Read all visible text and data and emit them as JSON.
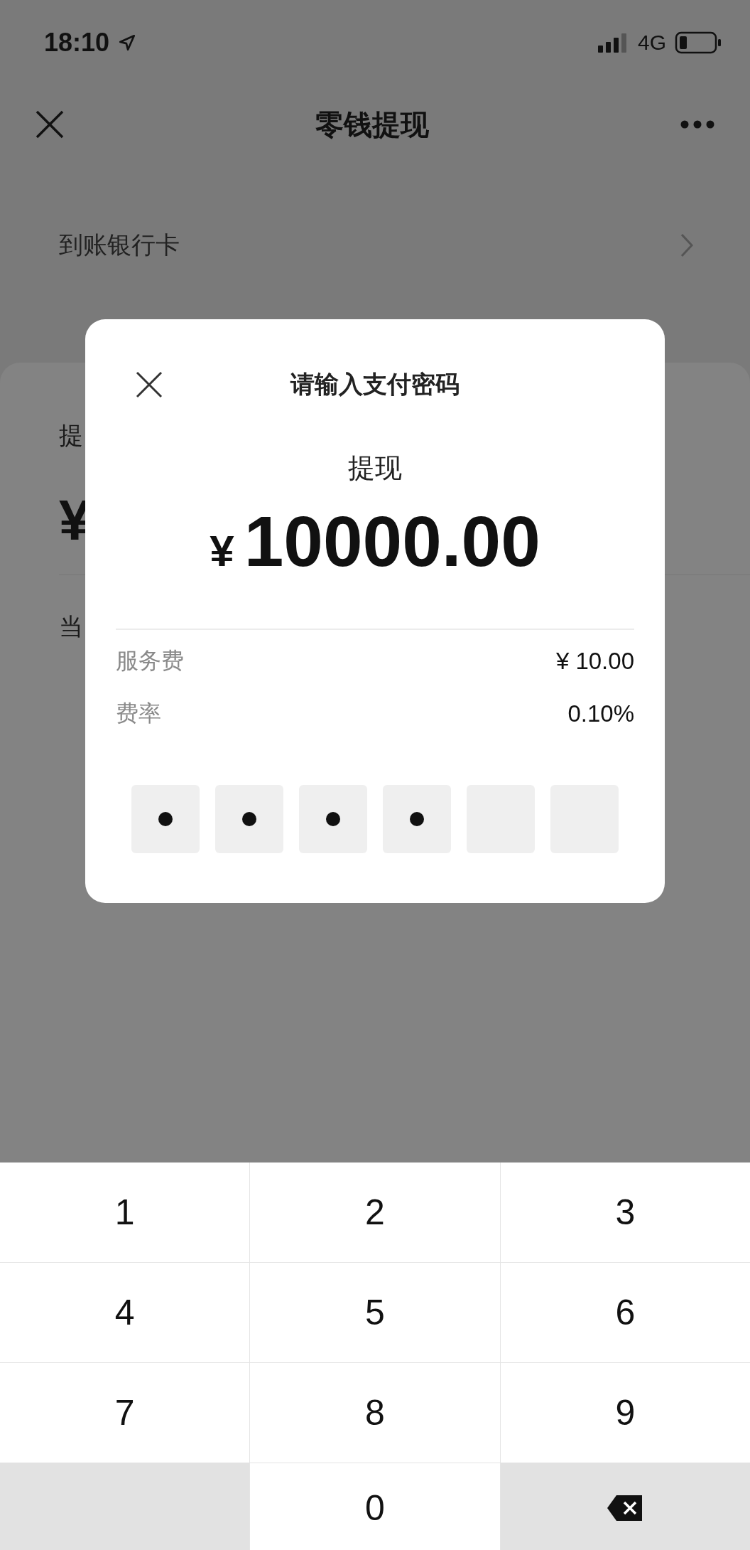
{
  "status_bar": {
    "time": "18:10",
    "network": "4G"
  },
  "nav": {
    "title": "零钱提现"
  },
  "bank_row": {
    "label": "到账银行卡"
  },
  "background_card": {
    "title_fragment": "提",
    "amount_fragment": "¥",
    "note_fragment": "当"
  },
  "dialog": {
    "title": "请输入支付密码",
    "subtitle": "提现",
    "currency": "¥",
    "amount": "10000.00",
    "details": [
      {
        "label": "服务费",
        "value": "¥ 10.00"
      },
      {
        "label": "费率",
        "value": "0.10%"
      }
    ],
    "pin": [
      {
        "filled": true
      },
      {
        "filled": true
      },
      {
        "filled": true
      },
      {
        "filled": true
      },
      {
        "filled": false
      },
      {
        "filled": false
      }
    ]
  },
  "keypad": [
    {
      "kind": "digit",
      "label": "1"
    },
    {
      "kind": "digit",
      "label": "2"
    },
    {
      "kind": "digit",
      "label": "3"
    },
    {
      "kind": "digit",
      "label": "4"
    },
    {
      "kind": "digit",
      "label": "5"
    },
    {
      "kind": "digit",
      "label": "6"
    },
    {
      "kind": "digit",
      "label": "7"
    },
    {
      "kind": "digit",
      "label": "8"
    },
    {
      "kind": "digit",
      "label": "9"
    },
    {
      "kind": "blank"
    },
    {
      "kind": "digit",
      "label": "0"
    },
    {
      "kind": "delete"
    }
  ]
}
